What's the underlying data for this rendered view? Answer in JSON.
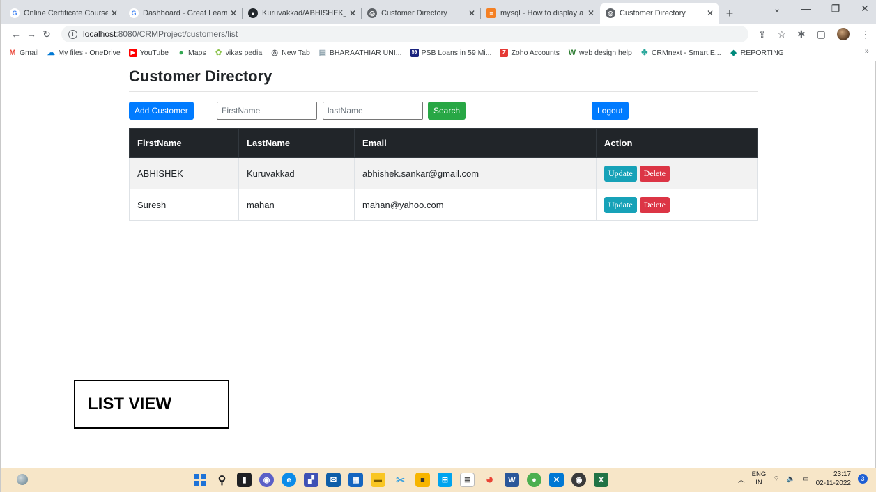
{
  "browser": {
    "tabs": [
      {
        "title": "Online Certificate Courses f",
        "favicon": "G",
        "color": "#4285f4",
        "active": false
      },
      {
        "title": "Dashboard - Great Learning",
        "favicon": "G",
        "color": "#4285f4",
        "active": false
      },
      {
        "title": "Kuruvakkad/ABHISHEK_ORI",
        "favicon": "github-icon",
        "color": "#24292e",
        "active": false
      },
      {
        "title": "Customer Directory",
        "favicon": "globe-icon",
        "color": "#5f6368",
        "active": false
      },
      {
        "title": "mysql - How to display a da",
        "favicon": "stackoverflow-icon",
        "color": "#f48024",
        "active": false
      },
      {
        "title": "Customer Directory",
        "favicon": "globe-icon",
        "color": "#5f6368",
        "active": true
      }
    ],
    "url_host": "localhost",
    "url_path": ":8080/CRMProject/customers/list",
    "bookmarks": [
      {
        "label": "Gmail",
        "icon": "M",
        "color": "#ea4335"
      },
      {
        "label": "My files - OneDrive",
        "icon": "☁",
        "color": "#0078d4"
      },
      {
        "label": "YouTube",
        "icon": "▶",
        "color": "#ff0000"
      },
      {
        "label": "Maps",
        "icon": "●",
        "color": "#34a853"
      },
      {
        "label": "vikas pedia",
        "icon": "✿",
        "color": "#8bc34a"
      },
      {
        "label": "New Tab",
        "icon": "◎",
        "color": "#5f6368"
      },
      {
        "label": "BHARAATHIAR UNI...",
        "icon": "▤",
        "color": "#90a4ae"
      },
      {
        "label": "PSB Loans in 59 Mi...",
        "icon": "59",
        "color": "#1a237e"
      },
      {
        "label": "Zoho Accounts",
        "icon": "Z",
        "color": "#e53935"
      },
      {
        "label": "web design help",
        "icon": "W",
        "color": "#2e7d32"
      },
      {
        "label": "CRMnext - Smart.E...",
        "icon": "✤",
        "color": "#26a69a"
      },
      {
        "label": "REPORTING",
        "icon": "◆",
        "color": "#00897b"
      }
    ],
    "bookmarks_more": "»"
  },
  "page": {
    "title": "Customer Directory",
    "add_button": "Add Customer",
    "first_name_placeholder": "FirstName",
    "last_name_placeholder": "lastName",
    "search_button": "Search",
    "logout_button": "Logout",
    "columns": [
      "FirstName",
      "LastName",
      "Email",
      "Action"
    ],
    "rows": [
      {
        "first": "ABHISHEK",
        "last": "Kuruvakkad",
        "email": "abhishek.sankar@gmail.com"
      },
      {
        "first": "Suresh",
        "last": "mahan",
        "email": "mahan@yahoo.com"
      }
    ],
    "update_label": "Update",
    "delete_label": "Delete"
  },
  "annotation": "LIST VIEW",
  "taskbar": {
    "lang_top": "ENG",
    "lang_bottom": "IN",
    "time": "23:17",
    "date": "02-11-2022",
    "notifications": "3"
  },
  "colors": {
    "primary": "#007bff",
    "success": "#28a745",
    "info": "#17a2b8",
    "danger": "#dc3545",
    "table_header": "#212529"
  }
}
